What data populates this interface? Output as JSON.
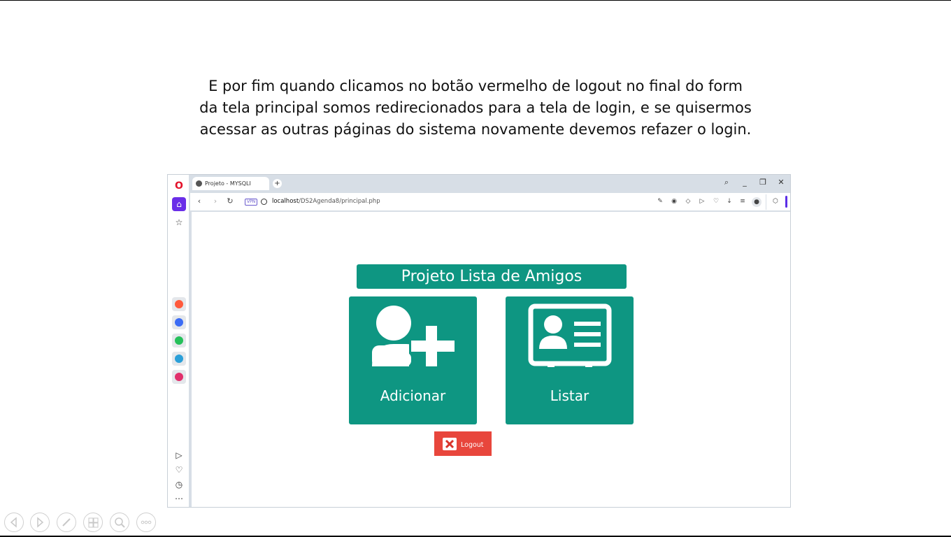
{
  "caption": {
    "line1": "E por fim quando clicamos no botão vermelho de logout no final do form",
    "line2": "da tela principal somos redirecionados para a tela de login, e se quisermos",
    "line3": "acessar as outras páginas do sistema novamente devemos refazer o login."
  },
  "browser": {
    "tab_title": "Projeto - MYSQLI",
    "new_tab": "+",
    "vpn_badge": "VPN",
    "url_host": "localhost",
    "url_path": "/DS2Agenda8/principal.php",
    "sidebar_icons": [
      "opera-logo-icon",
      "home-icon",
      "pinboard-icon",
      "aria-icon",
      "messenger-icon",
      "whatsapp-icon",
      "telegram-icon",
      "instagram-icon",
      "player-icon",
      "heart-icon",
      "history-icon",
      "more-icon"
    ],
    "toolbar_icons": [
      "snapshot-edit-icon",
      "camera-icon",
      "shield-icon",
      "play-icon",
      "heart-icon",
      "download-icon",
      "easy-setup-icon",
      "profile-icon",
      "extensions-icon"
    ]
  },
  "page": {
    "title": "Projeto Lista de Amigos",
    "add_label": "Adicionar",
    "list_label": "Listar",
    "logout_label": "Logout"
  },
  "colors": {
    "teal": "#0e9682",
    "logout_red": "#e8463c",
    "accent_purple": "#6a2ee8"
  }
}
